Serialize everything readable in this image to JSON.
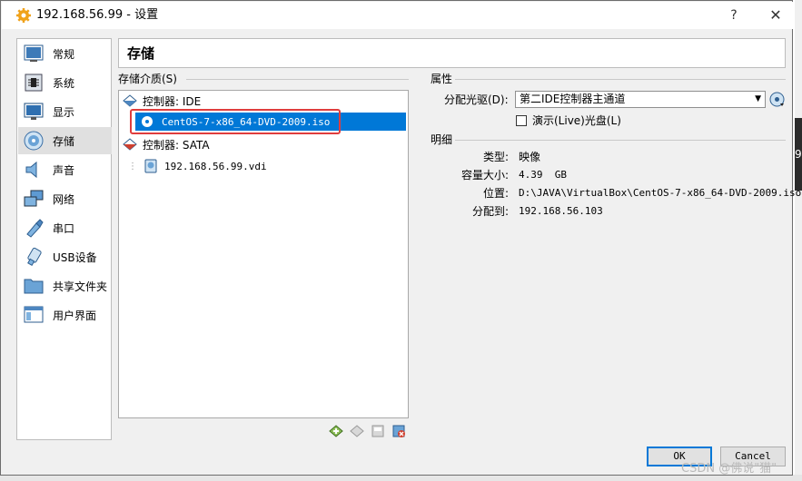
{
  "window": {
    "title": "192.168.56.99 - 设置",
    "help": "?",
    "close": "✕"
  },
  "nav": {
    "items": [
      {
        "label": "常规",
        "icon": "general-icon"
      },
      {
        "label": "系统",
        "icon": "system-icon"
      },
      {
        "label": "显示",
        "icon": "display-icon"
      },
      {
        "label": "存储",
        "icon": "storage-icon",
        "selected": true
      },
      {
        "label": "声音",
        "icon": "audio-icon"
      },
      {
        "label": "网络",
        "icon": "network-icon"
      },
      {
        "label": "串口",
        "icon": "serial-port-icon"
      },
      {
        "label": "USB设备",
        "icon": "usb-icon"
      },
      {
        "label": "共享文件夹",
        "icon": "shared-folder-icon"
      },
      {
        "label": "用户界面",
        "icon": "user-interface-icon"
      }
    ]
  },
  "page": {
    "title": "存储"
  },
  "storage": {
    "label": "存储介质(S)",
    "tree": {
      "controller_ide": "控制器: IDE",
      "iso": "CentOS-7-x86_64-DVD-2009.iso",
      "controller_sata": "控制器: SATA",
      "vdi": "192.168.56.99.vdi"
    },
    "toolbar": [
      "add-attachment-icon",
      "remove-attachment-icon",
      "add-controller-icon",
      "remove-controller-icon"
    ]
  },
  "attributes": {
    "label": "属性",
    "drive_label": "分配光驱(D):",
    "drive_value": "第二IDE控制器主通道",
    "live_cd_label": "演示(Live)光盘(L)",
    "live_cd_checked": false
  },
  "info": {
    "label": "明细",
    "type_key": "类型:",
    "type_value": "映像",
    "size_key": "容量大小:",
    "size_value": "4.39  GB",
    "location_key": "位置:",
    "location_value": "D:\\JAVA\\VirtualBox\\CentOS-7-x86_64-DVD-2009.iso",
    "attached_key": "分配到:",
    "attached_value": "192.168.56.103"
  },
  "buttons": {
    "ok": "OK",
    "cancel": "Cancel"
  },
  "watermark": "CSDN @佛说\"猫\"",
  "background_glyph": "9",
  "colors": {
    "selection": "#0078d7",
    "highlight_box": "#e03d3d"
  }
}
